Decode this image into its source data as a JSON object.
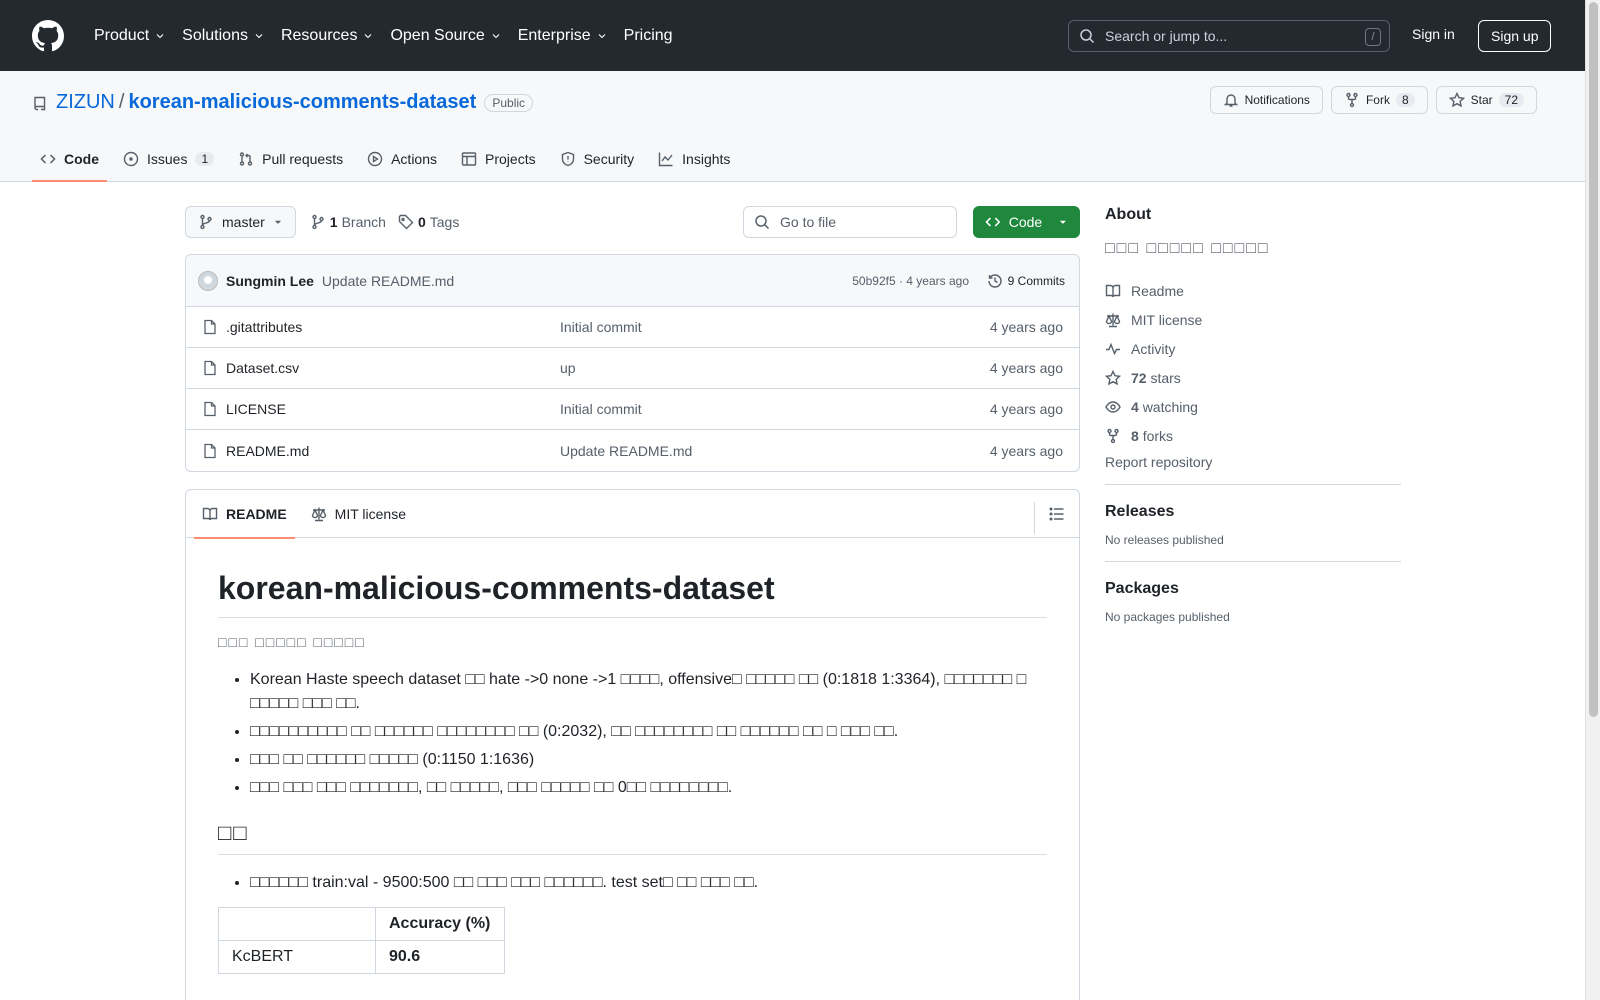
{
  "header": {
    "nav": [
      "Product",
      "Solutions",
      "Resources",
      "Open Source",
      "Enterprise",
      "Pricing"
    ],
    "search_placeholder": "Search or jump to...",
    "search_shortcut": "/",
    "sign_in": "Sign in",
    "sign_up": "Sign up"
  },
  "repo": {
    "owner": "ZIZUN",
    "separator": "/",
    "name": "korean-malicious-comments-dataset",
    "visibility": "Public",
    "notifications_label": "Notifications",
    "fork_label": "Fork",
    "fork_count": "8",
    "star_label": "Star",
    "star_count": "72",
    "tabs": [
      {
        "label": "Code",
        "count": ""
      },
      {
        "label": "Issues",
        "count": "1"
      },
      {
        "label": "Pull requests",
        "count": ""
      },
      {
        "label": "Actions",
        "count": ""
      },
      {
        "label": "Projects",
        "count": ""
      },
      {
        "label": "Security",
        "count": ""
      },
      {
        "label": "Insights",
        "count": ""
      }
    ]
  },
  "toolbar": {
    "branch": "master",
    "branch_count": "1",
    "branch_label": "Branch",
    "tag_count": "0",
    "tag_label": "Tags",
    "goto_placeholder": "Go to file",
    "code_button": "Code"
  },
  "commit": {
    "author": "Sungmin Lee",
    "message": "Update README.md",
    "meta": "50b92f5 · 4 years ago",
    "commits_label": "9 Commits"
  },
  "files": [
    {
      "name": ".gitattributes",
      "commit": "Initial commit",
      "age": "4 years ago"
    },
    {
      "name": "Dataset.csv",
      "commit": "up",
      "age": "4 years ago"
    },
    {
      "name": "LICENSE",
      "commit": "Initial commit",
      "age": "4 years ago"
    },
    {
      "name": "README.md",
      "commit": "Update README.md",
      "age": "4 years ago"
    }
  ],
  "readme": {
    "tab_readme": "README",
    "tab_license": "MIT license",
    "title": "korean-malicious-comments-dataset",
    "subtitle": "□□□ □□□□□ □□□□□",
    "bullets": [
      "Korean Haste speech dataset □□ hate ->0 none ->1 □□□□, offensive□ □□□□□ □□ (0:1818 1:3364), □□□□□□□ □ □□□□□ □□□ □□.",
      "□□□□□□□□□□ □□ □□□□□□ □□□□□□□□ □□ (0:2032), □□ □□□□□□□□ □□ □□□□□□ □□ □ □□□ □□.",
      "□□□ □□ □□□□□□ □□□□□ (0:1150 1:1636)",
      "□□□ □□□ □□□ □□□□□□□, □□ □□□□□, □□□ □□□□□ □□ 0□□ □□□□□□□□."
    ],
    "section2": "□□",
    "section2_bullet": "□□□□□□ train:val - 9500:500 □□ □□□ □□□ □□□□□□. test set□ □□ □□□ □□.",
    "table_header": [
      "",
      "Accuracy (%)"
    ],
    "table_rows": [
      [
        "KcBERT",
        "90.6"
      ]
    ]
  },
  "about": {
    "heading": "About",
    "description": "□□□ □□□□□ □□□□□",
    "items": [
      {
        "icon": "book-icon",
        "label": "Readme"
      },
      {
        "icon": "scale-icon",
        "label": "MIT license"
      },
      {
        "icon": "pulse-icon",
        "label": "Activity"
      },
      {
        "icon": "star-icon",
        "count": "72",
        "label": "stars"
      },
      {
        "icon": "eye-icon",
        "count": "4",
        "label": "watching"
      },
      {
        "icon": "fork-icon",
        "count": "8",
        "label": "forks"
      }
    ],
    "report": "Report repository",
    "releases_heading": "Releases",
    "releases_text": "No releases published",
    "packages_heading": "Packages",
    "packages_text": "No packages published"
  }
}
